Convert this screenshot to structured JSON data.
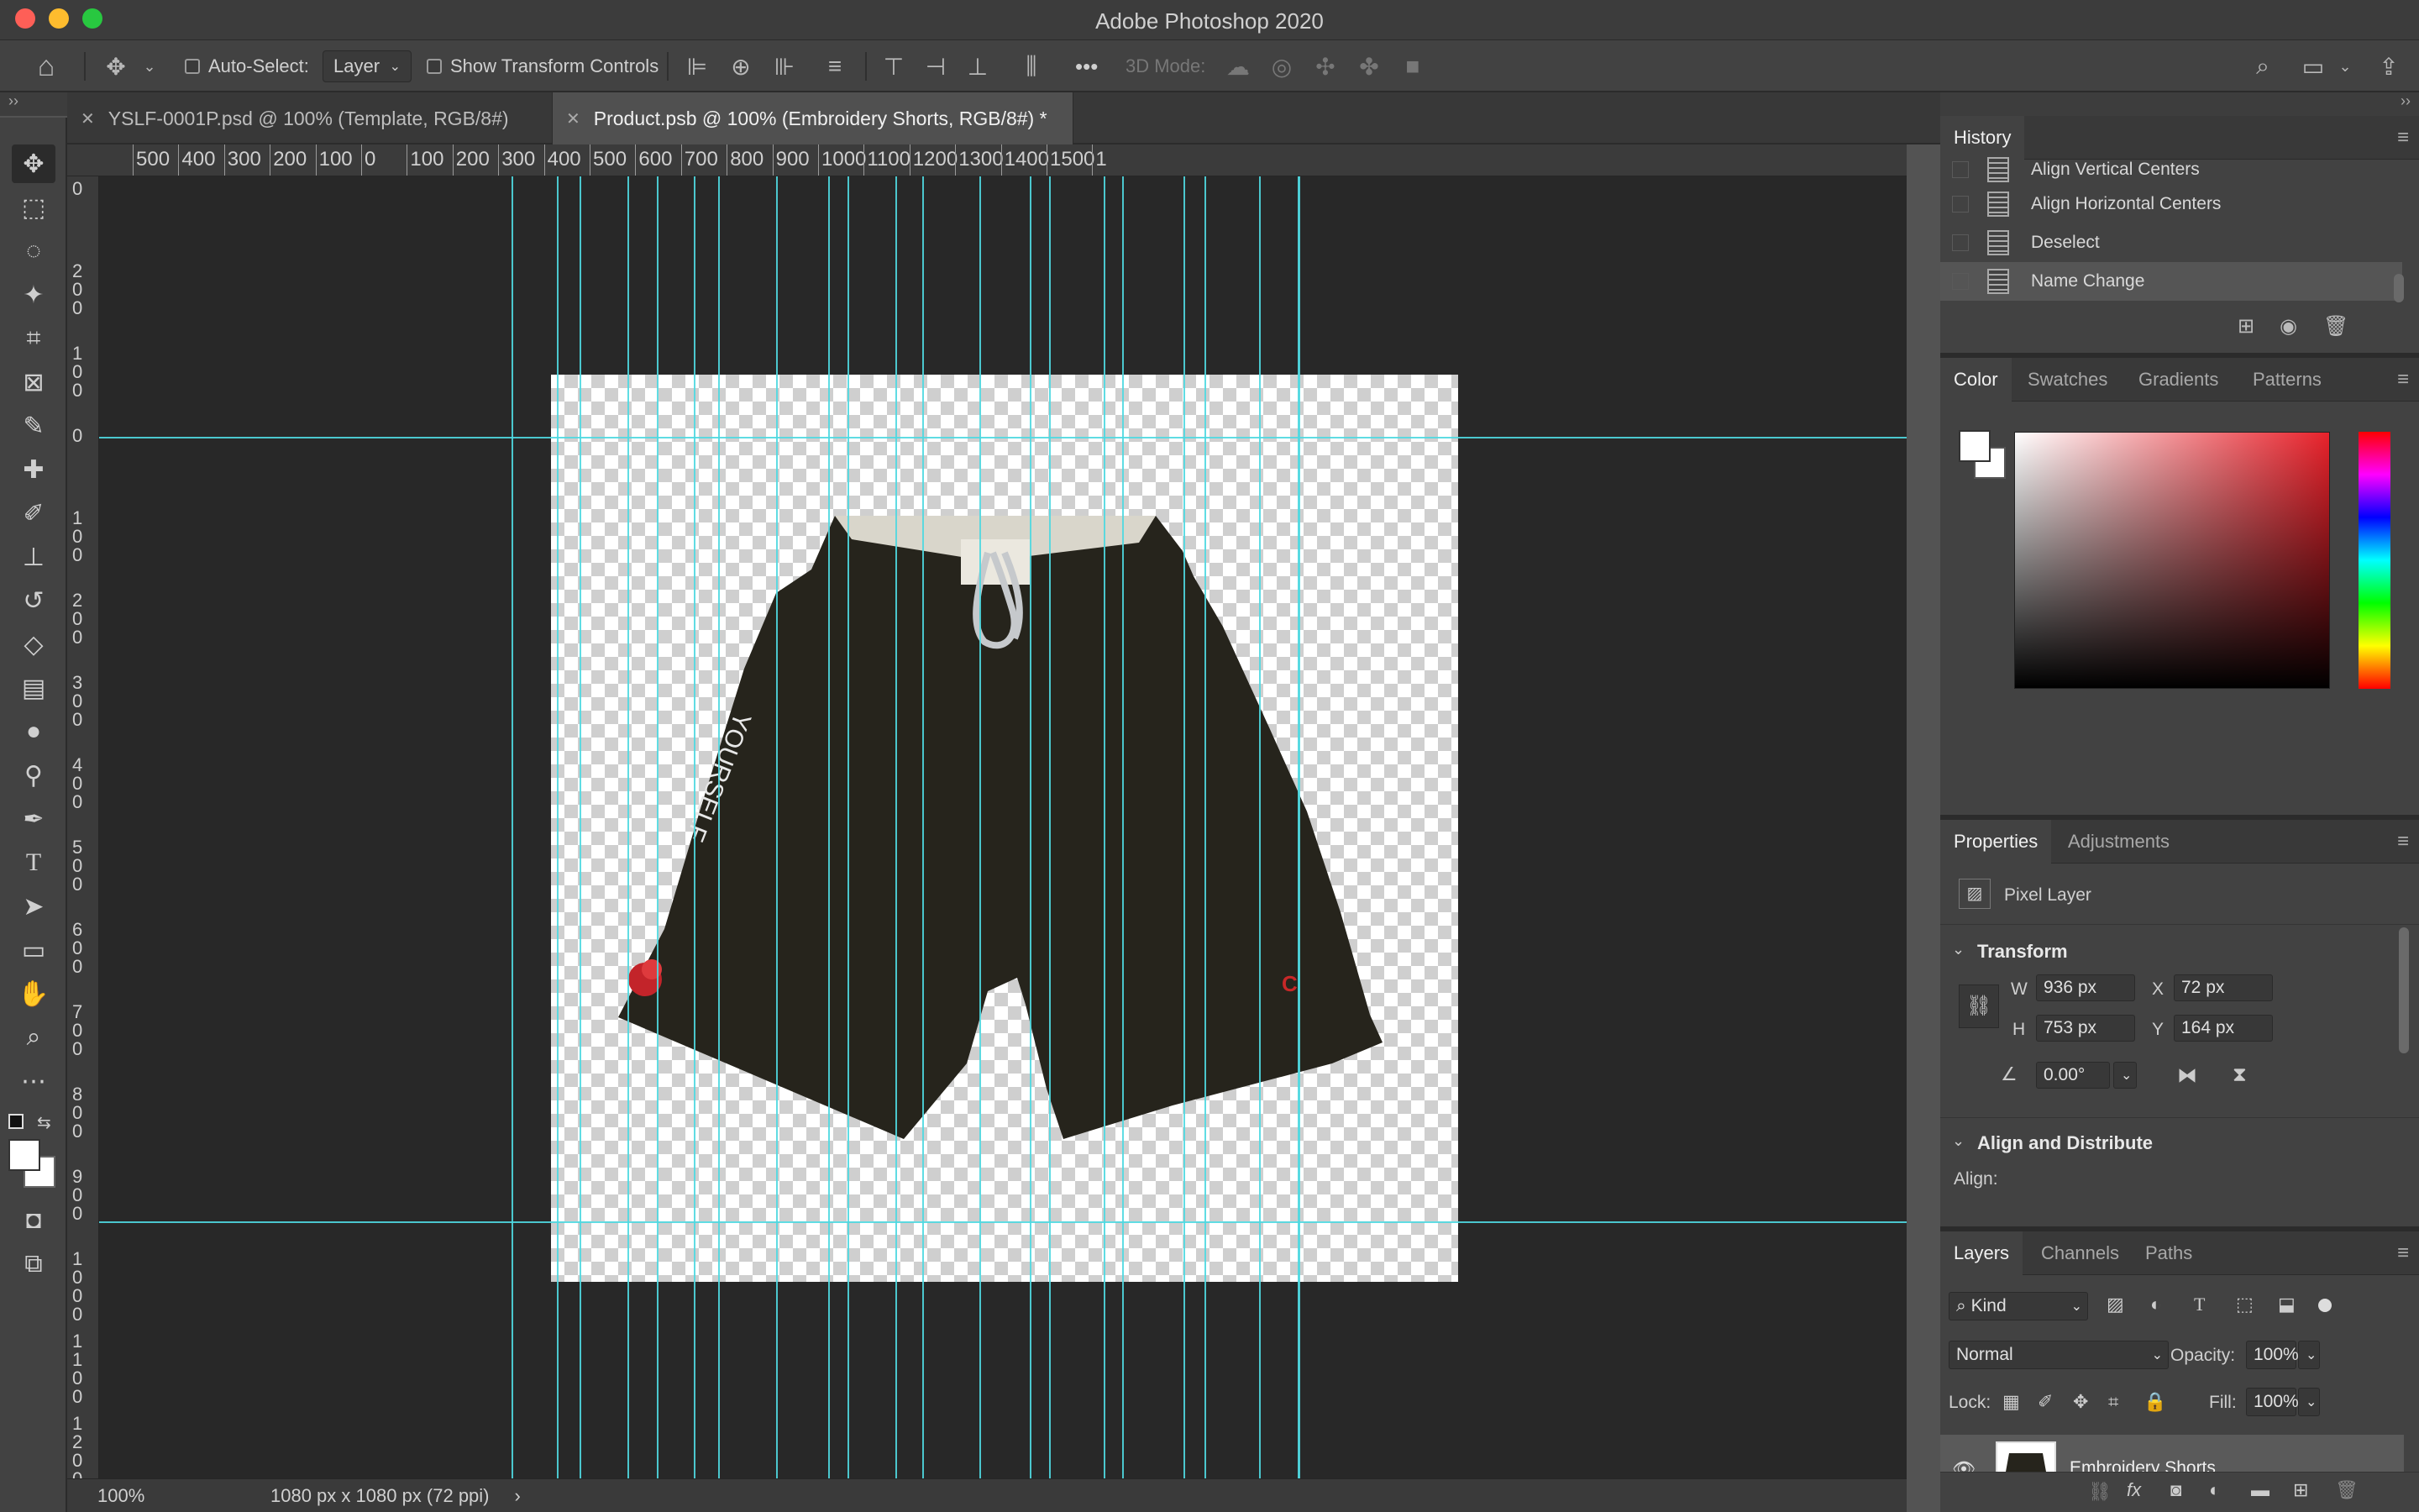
{
  "window": {
    "title": "Adobe Photoshop 2020"
  },
  "options_bar": {
    "auto_select_label": "Auto-Select:",
    "layer_dropdown": "Layer",
    "show_transform_label": "Show Transform Controls",
    "more_label": "•••",
    "three_d_label": "3D Mode:"
  },
  "tabs": [
    {
      "label": "YSLF-0001P.psd @ 100% (Template, RGB/8#)"
    },
    {
      "label": "Product.psb @ 100% (Embroidery Shorts, RGB/8#) *"
    }
  ],
  "ruler_top": [
    "500",
    "400",
    "300",
    "200",
    "100",
    "0",
    "100",
    "200",
    "300",
    "400",
    "500",
    "600",
    "700",
    "800",
    "900",
    "1000",
    "1100",
    "1200",
    "1300",
    "1400",
    "1500",
    "1"
  ],
  "ruler_left": [
    "0",
    "2\n0\n0",
    "1\n0\n0",
    "0",
    "1\n0\n0",
    "2\n0\n0",
    "3\n0\n0",
    "4\n0\n0",
    "5\n0\n0",
    "6\n0\n0",
    "7\n0\n0",
    "8\n0\n0",
    "9\n0\n0",
    "1\n0\n0\n0",
    "1\n1\n0\n0",
    "1\n2\n0\n0"
  ],
  "status": {
    "zoom": "100%",
    "doc_size": "1080 px x 1080 px (72 ppi)",
    "arrow": "›"
  },
  "history": {
    "tab": "History",
    "items": [
      "Align Vertical Centers",
      "Align Horizontal Centers",
      "Deselect",
      "Name Change"
    ]
  },
  "color_panel": {
    "tabs": [
      "Color",
      "Swatches",
      "Gradients",
      "Patterns"
    ]
  },
  "properties": {
    "tabs": [
      "Properties",
      "Adjustments"
    ],
    "layer_type": "Pixel Layer",
    "transform_title": "Transform",
    "w_label": "W",
    "w": "936 px",
    "x_label": "X",
    "x": "72 px",
    "h_label": "H",
    "h": "753 px",
    "y_label": "Y",
    "y": "164 px",
    "angle": "0.00°",
    "align_title": "Align and Distribute",
    "align_label": "Align:"
  },
  "layers": {
    "tabs": [
      "Layers",
      "Channels",
      "Paths"
    ],
    "kind": "Kind",
    "blend": "Normal",
    "opacity_label": "Opacity:",
    "opacity": "100%",
    "lock_label": "Lock:",
    "fill_label": "Fill:",
    "fill": "100%",
    "layer_name": "Embroidery Shorts"
  },
  "artwork": {
    "shorts_text": "YOURSELF"
  },
  "colors": {
    "guide": "#4fd8e0",
    "panel": "#424242",
    "canvas_bg": "#282828"
  }
}
